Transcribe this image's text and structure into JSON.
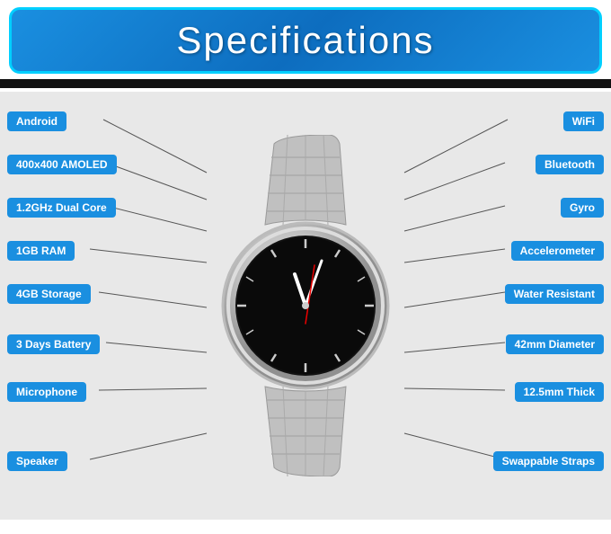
{
  "header": {
    "title": "Specifications",
    "border_color": "#00cfff",
    "bg_gradient": "#1a8fe0"
  },
  "specs": {
    "left": [
      {
        "id": "android",
        "label": "Android",
        "class": "label-android"
      },
      {
        "id": "amoled",
        "label": "400x400 AMOLED",
        "class": "label-amoled"
      },
      {
        "id": "dualcore",
        "label": "1.2GHz Dual Core",
        "class": "label-dualcore"
      },
      {
        "id": "ram",
        "label": "1GB RAM",
        "class": "label-ram"
      },
      {
        "id": "storage",
        "label": "4GB Storage",
        "class": "label-storage"
      },
      {
        "id": "battery",
        "label": "3 Days Battery",
        "class": "label-battery"
      },
      {
        "id": "microphone",
        "label": "Microphone",
        "class": "label-microphone"
      },
      {
        "id": "speaker",
        "label": "Speaker",
        "class": "label-speaker"
      }
    ],
    "right": [
      {
        "id": "wifi",
        "label": "WiFi",
        "class": "label-wifi"
      },
      {
        "id": "bluetooth",
        "label": "Bluetooth",
        "class": "label-bluetooth"
      },
      {
        "id": "gyro",
        "label": "Gyro",
        "class": "label-gyro"
      },
      {
        "id": "accelerometer",
        "label": "Accelerometer",
        "class": "label-accelerometer"
      },
      {
        "id": "water",
        "label": "Water Resistant",
        "class": "label-water"
      },
      {
        "id": "diameter",
        "label": "42mm Diameter",
        "class": "label-diameter"
      },
      {
        "id": "thick",
        "label": "12.5mm Thick",
        "class": "label-thick"
      },
      {
        "id": "straps",
        "label": "Swappable Straps",
        "class": "label-straps"
      }
    ]
  }
}
